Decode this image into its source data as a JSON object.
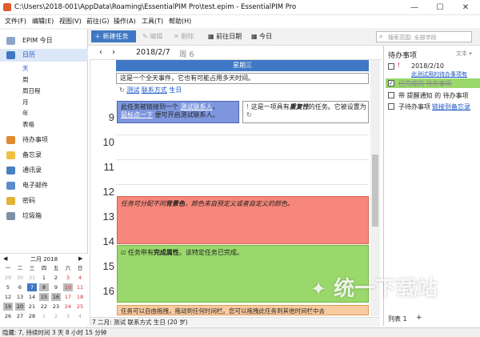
{
  "window": {
    "title": "C:\\Users\\2018-001\\AppData\\Roaming\\EssentialPIM Pro\\test.epim - EssentialPIM Pro",
    "minimize": "—",
    "maximize": "☐",
    "close": "✕"
  },
  "menu": [
    "文件(F)",
    "编辑(E)",
    "视图(V)",
    "前往(G)",
    "操作(A)",
    "工具(T)",
    "帮助(H)"
  ],
  "toolbar": {
    "new_task": "新建任务",
    "edit": "编辑",
    "delete": "删除",
    "prev_date": "前往日期",
    "today": "今日",
    "search_placeholder": "搜索范围: 全部字段"
  },
  "sidebar": {
    "items": [
      {
        "label": "EPIM 今日"
      },
      {
        "label": "日历"
      },
      {
        "label": "待办事项"
      },
      {
        "label": "备忘录"
      },
      {
        "label": "通讯录"
      },
      {
        "label": "电子邮件"
      },
      {
        "label": "密码"
      },
      {
        "label": "垃圾箱"
      }
    ],
    "views": [
      "天",
      "周",
      "周日程",
      "月",
      "年",
      "表格"
    ]
  },
  "minical": {
    "title": "二月 2018",
    "weekdays": [
      "一",
      "二",
      "三",
      "四",
      "五",
      "六",
      "日"
    ],
    "rows": [
      [
        "29",
        "30",
        "31",
        "1",
        "2",
        "3",
        "4"
      ],
      [
        "5",
        "6",
        "7",
        "8",
        "9",
        "10",
        "11"
      ],
      [
        "12",
        "13",
        "14",
        "15",
        "16",
        "17",
        "18"
      ],
      [
        "19",
        "20",
        "21",
        "22",
        "23",
        "24",
        "25"
      ],
      [
        "26",
        "27",
        "28",
        "1",
        "2",
        "3",
        "4"
      ]
    ]
  },
  "calendar": {
    "date": "2018/2/7",
    "weekday": "周 6",
    "day_header": "星期三",
    "allday_event": "这是一个全天事件，它也有可能占用多天时间。",
    "birthday_event": {
      "prefix": "测试",
      "link": "联系方式",
      "suffix": "生日"
    },
    "hours": [
      "9",
      "10",
      "11",
      "12",
      "13",
      "14",
      "15",
      "16",
      "17"
    ],
    "event_blue": {
      "t1": "此任务被链接到一个",
      "link1": "测试联系人",
      "t2": "。",
      "link2": "鼠标点一下",
      "t3": "便可开启测试联系人。"
    },
    "event_repeat": {
      "t1": "这是一项具有",
      "emph": "重复性",
      "t2": "的任务。它被设置为"
    },
    "event_red": {
      "t1": "任务可分配不同",
      "b1": "背景色",
      "t2": "，颜色来自预定义或者自定义的颜色。"
    },
    "event_green": {
      "t1": "任务带有",
      "b1": "完成属性",
      "t2": "。该特定任务已完成。"
    },
    "event_orange": {
      "text": "任务可以自由拖拽，拖动到任何时间栏。您可以拖拽此任务到其他时间栏中去"
    },
    "footer": "7 二月: 测试 联系方式 生日 (20 岁)"
  },
  "tasks": {
    "title": "待办事项",
    "text_btn": "文本",
    "items": [
      {
        "date": "2018/2/10",
        "sub": "此测试用的待办事项有",
        "done": false,
        "flag": "!"
      },
      {
        "label": "已完成的 待办事项",
        "done": true
      },
      {
        "label": "带 提醒通知 的 待办事项",
        "done": false
      },
      {
        "label": "子待办事项",
        "link": "链接到备忘录",
        "done": false
      }
    ],
    "list_tab": "列表 1",
    "add": "+"
  },
  "status": "隐藏: 7, 持续时间 3 天 8 小时 15 分钟",
  "watermark": "统一下载站"
}
